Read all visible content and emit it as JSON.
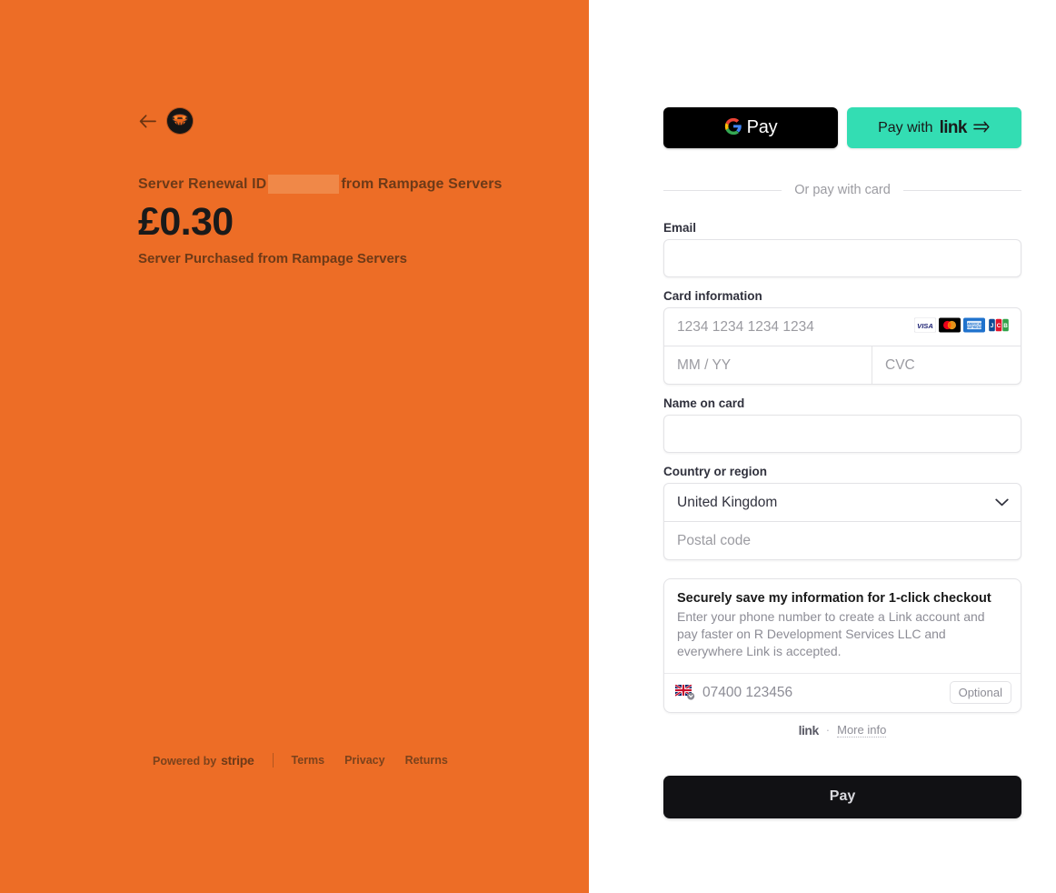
{
  "left": {
    "back_icon": "back-arrow-icon",
    "logo": "merchant-logo-icon",
    "description_prefix": "Server Renewal ID",
    "description_suffix": "from Rampage Servers",
    "amount": "£0.30",
    "sub_description": "Server Purchased from Rampage Servers",
    "footer": {
      "powered_by": "Powered by",
      "stripe": "stripe",
      "terms": "Terms",
      "privacy": "Privacy",
      "returns": "Returns"
    }
  },
  "right": {
    "wallets": {
      "google_pay_label": "Pay",
      "google_pay_icon": "google-g-icon",
      "link_pay_prefix": "Pay with",
      "link_wordmark": "link",
      "link_arrow_icon": "double-arrow-right-icon"
    },
    "divider_text": "Or pay with card",
    "email": {
      "label": "Email",
      "value": "",
      "placeholder": ""
    },
    "card": {
      "label": "Card information",
      "number_placeholder": "1234 1234 1234 1234",
      "number_value": "",
      "expiry_placeholder": "MM / YY",
      "expiry_value": "",
      "cvc_placeholder": "CVC",
      "cvc_value": "",
      "brands": [
        "visa",
        "mastercard",
        "amex",
        "jcb"
      ],
      "cvc_icon": "card-cvc-icon"
    },
    "name_on_card": {
      "label": "Name on card",
      "value": "",
      "placeholder": ""
    },
    "country": {
      "label": "Country or region",
      "selected": "United Kingdom",
      "options": [
        "United Kingdom"
      ],
      "chevron_icon": "chevron-down-icon",
      "postal_placeholder": "Postal code",
      "postal_value": ""
    },
    "save_info": {
      "title": "Securely save my information for 1-click checkout",
      "description": "Enter your phone number to create a Link account and pay faster on R Development Services LLC and everywhere Link is accepted.",
      "flag_icon": "uk-flag-icon",
      "phone_placeholder": "07400 123456",
      "phone_value": "",
      "optional_badge": "Optional",
      "footer_mark": "link",
      "footer_dot": "·",
      "footer_more": "More info"
    },
    "pay_button": "Pay"
  },
  "colors": {
    "background_orange": "#ED6D26",
    "redacted_orange": "#F08848",
    "link_green": "#33DDB3",
    "pay_button_dark": "#111114",
    "label_text": "#30313d",
    "placeholder_text": "#9b9ba1"
  }
}
